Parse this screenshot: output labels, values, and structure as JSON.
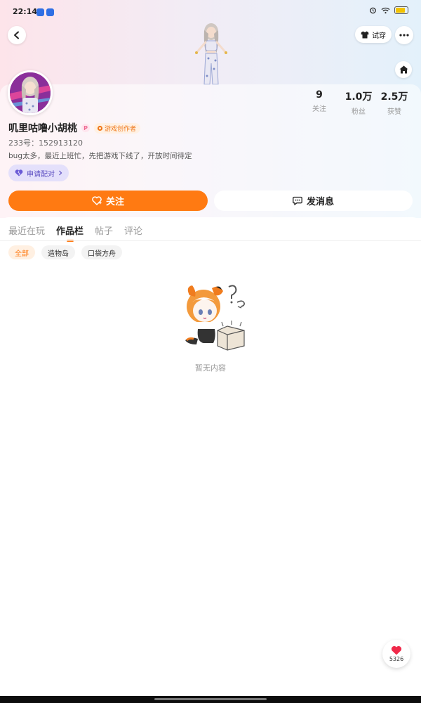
{
  "status_bar": {
    "time": "22:14"
  },
  "header": {
    "tryon_label": "试穿"
  },
  "profile": {
    "username": "叽里咕噜小胡桃",
    "badge_letter": "P",
    "creator_badge": "游戏创作者",
    "id_line": "233号：152913120",
    "bio": "bug太多，最近上班忙，先把游戏下线了，开放时间待定",
    "match_label": "申请配对"
  },
  "stats": [
    {
      "value": "9",
      "label": "关注"
    },
    {
      "value": "1.0万",
      "label": "粉丝"
    },
    {
      "value": "2.5万",
      "label": "获赞"
    }
  ],
  "actions": {
    "follow_label": "关注",
    "message_label": "发消息"
  },
  "tabs": [
    {
      "label": "最近在玩",
      "active": false
    },
    {
      "label": "作品栏",
      "active": true
    },
    {
      "label": "帖子",
      "active": false
    },
    {
      "label": "评论",
      "active": false
    }
  ],
  "filters": [
    {
      "label": "全部",
      "active": true
    },
    {
      "label": "造物岛",
      "active": false
    },
    {
      "label": "口袋方舟",
      "active": false
    }
  ],
  "empty_state": {
    "text": "暂无内容"
  },
  "like_fab": {
    "count": "5326"
  },
  "colors": {
    "accent": "#ff7a12",
    "match_purple": "#5d4fc2",
    "badge_bg": "#e4e0fb"
  },
  "icons": [
    "back-icon",
    "shirt-icon",
    "more-icon",
    "home-icon",
    "heart-icon",
    "chat-icon",
    "follow-heart-icon",
    "chevron-right-icon"
  ]
}
